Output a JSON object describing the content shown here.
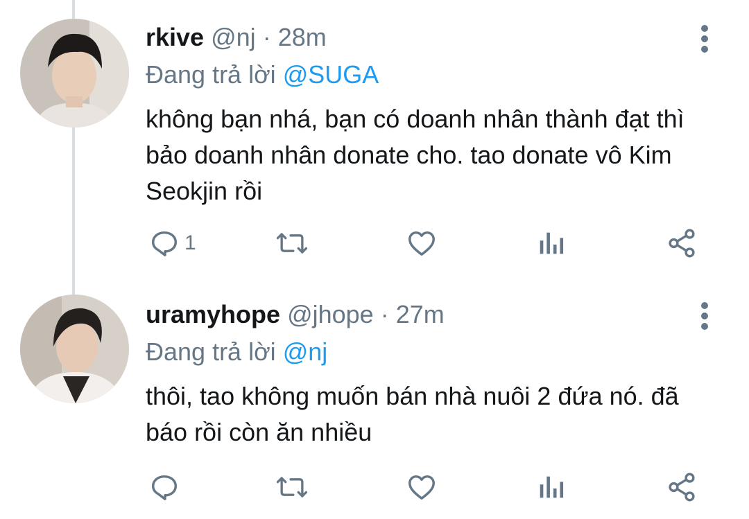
{
  "tweets": [
    {
      "name": "rkive",
      "handle": "@nj",
      "separator": "·",
      "time": "28m",
      "replying_prefix": "Đang trả lời",
      "replying_to": "@SUGA",
      "text": "không bạn nhá, bạn có doanh nhân thành đạt thì bảo doanh nhân donate cho. tao donate vô Kim Seokjin rồi",
      "reply_count": "1",
      "icons": [
        "reply-icon",
        "retweet-icon",
        "like-icon",
        "analytics-icon",
        "share-icon",
        "more-icon"
      ]
    },
    {
      "name": "uramyhope",
      "handle": "@jhope",
      "separator": "·",
      "time": "27m",
      "replying_prefix": "Đang trả lời",
      "replying_to": "@nj",
      "text": "thôi, tao không muốn bán nhà nuôi 2 đứa nó. đã báo rồi còn ăn nhiều",
      "reply_count": "",
      "icons": [
        "reply-icon",
        "retweet-icon",
        "like-icon",
        "analytics-icon",
        "share-icon",
        "more-icon"
      ]
    }
  ],
  "colors": {
    "text": "#14171a",
    "secondary": "#657786",
    "link": "#1d9bf0",
    "thread_line": "#d8dde2"
  }
}
